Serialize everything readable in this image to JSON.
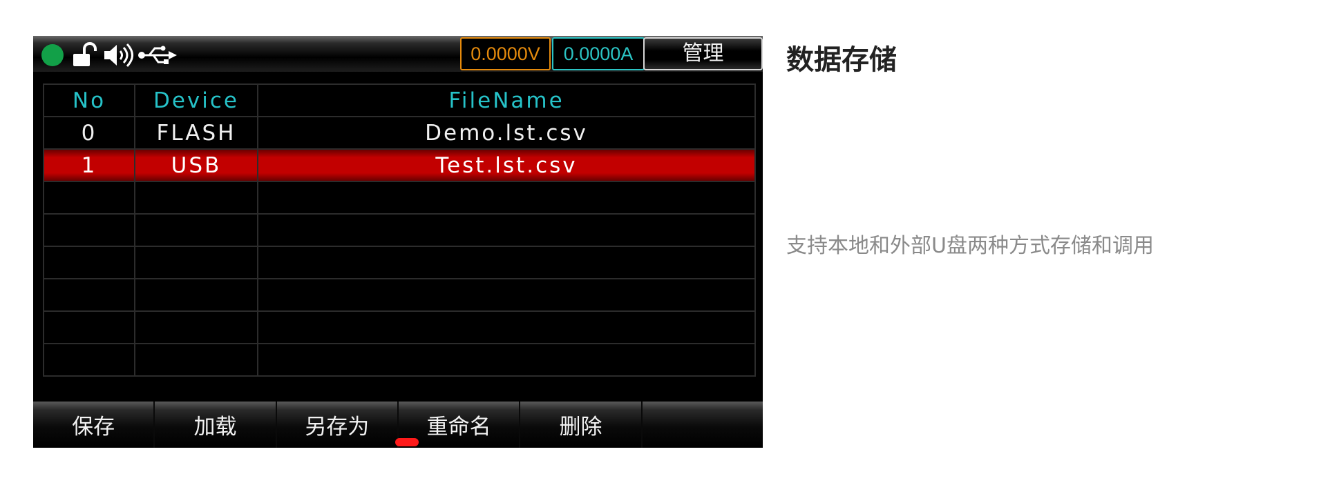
{
  "status_bar": {
    "status_color": "#12a048",
    "icons": [
      "unlock-icon",
      "speaker-icon",
      "usb-icon"
    ],
    "voltage": "0.0000V",
    "current": "0.0000A",
    "manage_label": "管理"
  },
  "table": {
    "headers": {
      "no": "No",
      "device": "Device",
      "filename": "FileName"
    },
    "rows": [
      {
        "no": "0",
        "device": "FLASH",
        "filename": "Demo.lst.csv",
        "selected": false
      },
      {
        "no": "1",
        "device": "USB",
        "filename": "Test.lst.csv",
        "selected": true
      }
    ],
    "empty_rows": 6
  },
  "softkeys": {
    "save": "保存",
    "load": "加载",
    "save_as": "另存为",
    "rename": "重命名",
    "delete": "删除",
    "empty": ""
  },
  "colors": {
    "voltage": "#e58a0c",
    "current": "#2bc4c4",
    "header_text": "#26c2c8",
    "selected_row": "#c20000",
    "page_indicator": "#ff1a1a"
  },
  "info": {
    "title": "数据存储",
    "description": "支持本地和外部U盘两种方式存储和调用"
  }
}
